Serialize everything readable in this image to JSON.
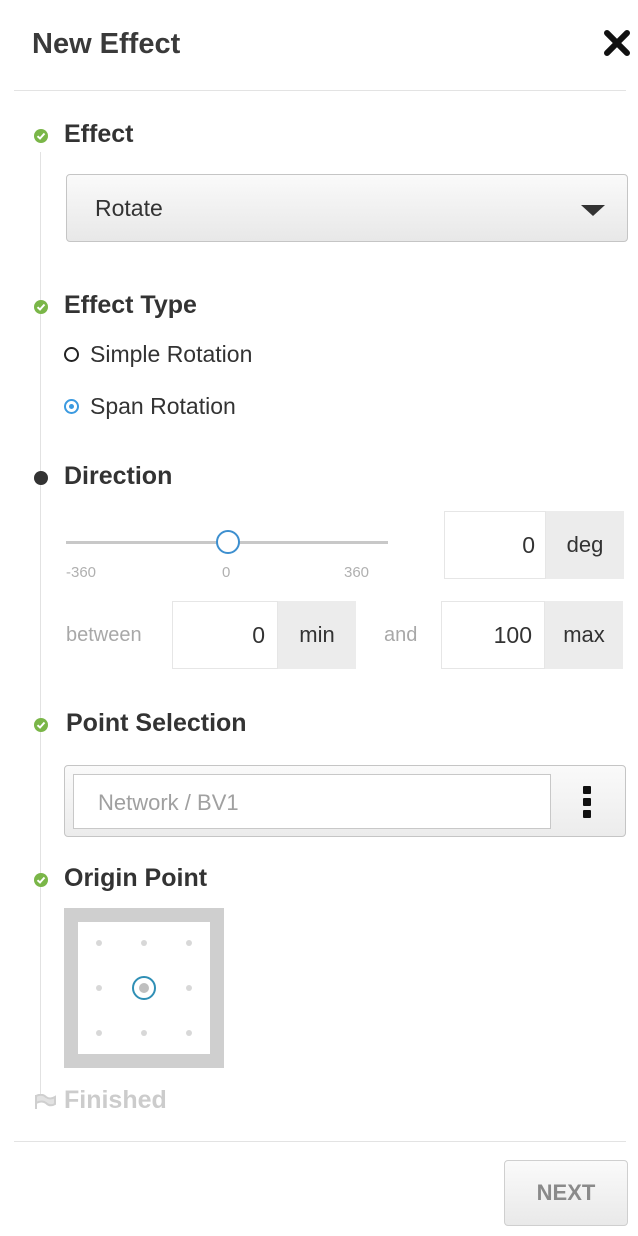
{
  "dialog": {
    "title": "New Effect"
  },
  "steps": {
    "effect": {
      "label": "Effect",
      "select_value": "Rotate"
    },
    "effect_type": {
      "label": "Effect Type",
      "options": [
        {
          "label": "Simple Rotation",
          "selected": false
        },
        {
          "label": "Span Rotation",
          "selected": true
        }
      ]
    },
    "direction": {
      "label": "Direction",
      "slider": {
        "min_label": "-360",
        "mid_label": "0",
        "max_label": "360",
        "value": 0
      },
      "deg_value": "0",
      "deg_unit": "deg",
      "between_label": "between",
      "min_value": "0",
      "min_unit": "min",
      "and_label": "and",
      "max_value": "100",
      "max_unit": "max"
    },
    "point_selection": {
      "label": "Point Selection",
      "placeholder": "Network / BV1"
    },
    "origin_point": {
      "label": "Origin Point",
      "selected": "center"
    },
    "finished": {
      "label": "Finished"
    }
  },
  "footer": {
    "next_label": "NEXT"
  },
  "colors": {
    "success": "#7ab648",
    "radio_accent": "#3b9ae0",
    "slider_accent": "#3d8fcf",
    "origin_accent": "#2f8fb5"
  }
}
